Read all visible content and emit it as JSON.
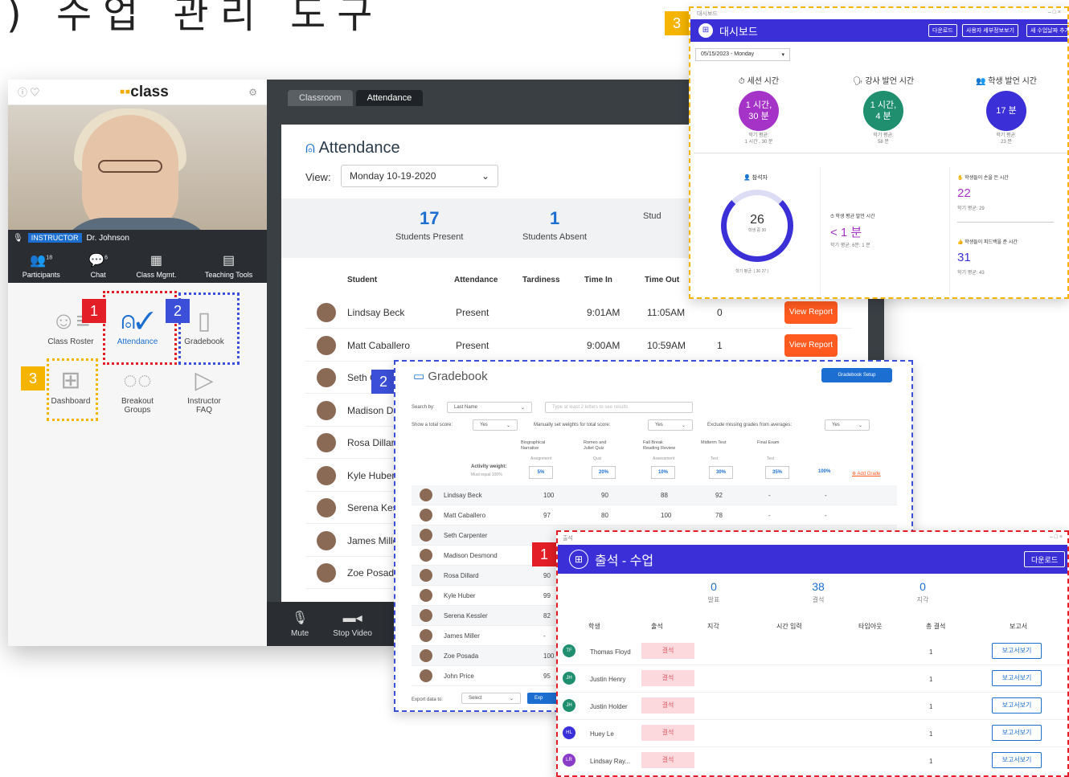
{
  "slide": {
    "title": ") 수업 관리 도구"
  },
  "app": {
    "logo": "class",
    "instructor_badge": "INSTRUCTOR",
    "instructor_name": "Dr. Johnson",
    "toolbar": [
      {
        "label": "Participants",
        "count": "18",
        "icon": "participants-icon"
      },
      {
        "label": "Chat",
        "count": "6",
        "icon": "chat-icon"
      },
      {
        "label": "Class Mgmt.",
        "icon": "class-mgmt-icon"
      },
      {
        "label": "Teaching Tools",
        "icon": "teaching-tools-icon"
      }
    ],
    "grid": [
      {
        "label": "Class Roster",
        "icon": "roster-icon"
      },
      {
        "label": "Attendance",
        "icon": "attendance-icon"
      },
      {
        "label": "Gradebook",
        "icon": "gradebook-icon"
      },
      {
        "label": "Dashboard",
        "icon": "dashboard-icon"
      },
      {
        "label": "Breakout\nGroups",
        "icon": "breakout-icon"
      },
      {
        "label": "Instructor\nFAQ",
        "icon": "faq-icon"
      }
    ],
    "tabs": [
      "Classroom",
      "Attendance"
    ],
    "attendance": {
      "title": "Attendance",
      "view_label": "View:",
      "view_value": "Monday 10-19-2020",
      "stats": [
        {
          "value": "17",
          "label": "Students Present"
        },
        {
          "value": "1",
          "label": "Students Absent"
        },
        {
          "value": "",
          "label": "Stud"
        }
      ],
      "columns": [
        "Student",
        "Attendance",
        "Tardiness",
        "Time In",
        "Time Out"
      ],
      "rows": [
        {
          "name": "Lindsay Beck",
          "attendance": "Present",
          "time_in": "9:01AM",
          "time_out": "11:05AM",
          "extra": "0",
          "action": "View Report"
        },
        {
          "name": "Matt Caballero",
          "attendance": "Present",
          "time_in": "9:00AM",
          "time_out": "10:59AM",
          "extra": "1",
          "action": "View Report"
        },
        {
          "name": "Seth C"
        },
        {
          "name": "Madison D"
        },
        {
          "name": "Rosa Dillar"
        },
        {
          "name": "Kyle Huber"
        },
        {
          "name": "Serena Kes"
        },
        {
          "name": "James Mille"
        },
        {
          "name": "Zoe Posada"
        }
      ]
    },
    "bottom": [
      {
        "label": "Mute",
        "icon": "mic-icon"
      },
      {
        "label": "Stop Video",
        "icon": "video-icon"
      }
    ]
  },
  "badges": {
    "one": "1",
    "two": "2",
    "three": "3"
  },
  "dashboard": {
    "window_label": "대시보드",
    "title": "대시보드",
    "buttons": [
      "다운로드",
      "사용자 세부정보보기",
      "새 수업날짜 추가"
    ],
    "date": "05/15/2023 - Monday",
    "metrics": [
      {
        "title": "세션 시간",
        "value": "1 시간,\n30 분",
        "sub": "학기 평균:\n1 시간 , 30 분",
        "color": "#a533c8"
      },
      {
        "title": "강사 발언 시간",
        "value": "1 시간,\n4 분",
        "sub": "학기 평균:\n58 분",
        "color": "#1f8f70"
      },
      {
        "title": "학생 발언 시간",
        "value": "17 분",
        "sub": "학기 평균:\n23 분",
        "color": "#3b2fd8"
      }
    ],
    "participants_label": "참석자",
    "ring_value": "26",
    "ring_sub": "학생 중 30",
    "ring_avg": "학기 평균: ( 30 27 )",
    "avg_speak_label": "학생 평균 발언 시간",
    "avg_speak_value": "< 1 분",
    "avg_speak_sub": "학기 평균: 6분: 1 분",
    "hands_label": "학생들이 손을 든 시간",
    "hands_value": "22",
    "hands_sub": "학기 평균: 29",
    "feedback_label": "학생들이 피드백을 준 시간",
    "feedback_value": "31",
    "feedback_sub": "학기 평균: 43"
  },
  "gradebook": {
    "title": "Gradebook",
    "setup": "Gradebook Setup",
    "search_by": "Search by:",
    "search_sel": "Last Name",
    "search_ph": "Type at least 2 letters to see results",
    "show_total": "Show a total score:",
    "show_total_val": "Yes",
    "manual": "Manually set weights for total score:",
    "manual_val": "Yes",
    "exclude": "Exclude missing grades from averages:",
    "exclude_val": "Yes",
    "assignments": [
      {
        "name": "Biographical\nNarrative",
        "type": "Assignment",
        "weight": "5%"
      },
      {
        "name": "Romeo and\nJuliet Quiz",
        "type": "Quiz",
        "weight": "20%"
      },
      {
        "name": "Fall Break\nReading Review",
        "type": "Assessment",
        "weight": "10%"
      },
      {
        "name": "Midterm Test",
        "type": "Test",
        "weight": "30%"
      },
      {
        "name": "Final Exam",
        "type": "Test",
        "weight": "35%"
      }
    ],
    "activity_weight": "Activity weight:",
    "must_equal": "Must equal 100%",
    "total_weight": "100%",
    "add_grade": "Add Grade",
    "rows": [
      {
        "name": "Lindsay Beck",
        "s": [
          "100",
          "90",
          "88",
          "92",
          "-",
          "-"
        ]
      },
      {
        "name": "Matt Caballero",
        "s": [
          "97",
          "80",
          "100",
          "78",
          "-",
          "-"
        ]
      },
      {
        "name": "Seth Carpenter",
        "s": []
      },
      {
        "name": "Madison Desmond",
        "s": []
      },
      {
        "name": "Rosa Dillard",
        "s": [
          "90"
        ]
      },
      {
        "name": "Kyle Huber",
        "s": [
          "99"
        ]
      },
      {
        "name": "Serena Kessler",
        "s": [
          "82"
        ]
      },
      {
        "name": "James Miller",
        "s": [
          "-"
        ]
      },
      {
        "name": "Zoe Posada",
        "s": [
          "100"
        ]
      },
      {
        "name": "John Price",
        "s": [
          "95"
        ]
      }
    ],
    "export": "Export data to:",
    "export_sel": "Select",
    "export_btn": "Exp"
  },
  "attendance_kr": {
    "window_label": "출석",
    "title": "출석 - 수업",
    "download": "다운로드",
    "stats": [
      {
        "value": "0",
        "label": "발표"
      },
      {
        "value": "38",
        "label": "결석"
      },
      {
        "value": "0",
        "label": "지각"
      }
    ],
    "columns": [
      "학생",
      "출석",
      "지각",
      "시간 입력",
      "타임아웃",
      "총 결석",
      "보고서"
    ],
    "rows": [
      {
        "initials": "TF",
        "name": "Thomas Floyd",
        "status": "결석",
        "total": "1",
        "report": "보고서보기",
        "color": "#1f8f70"
      },
      {
        "initials": "JH",
        "name": "Justin Henry",
        "status": "결석",
        "total": "1",
        "report": "보고서보기",
        "color": "#1f8f70"
      },
      {
        "initials": "JH",
        "name": "Justin Holder",
        "status": "결석",
        "total": "1",
        "report": "보고서보기",
        "color": "#1f8f70"
      },
      {
        "initials": "HL",
        "name": "Huey Le",
        "status": "결석",
        "total": "1",
        "report": "보고서보기",
        "color": "#3b2fd8"
      },
      {
        "initials": "LR",
        "name": "Lindsay Ray...",
        "status": "결석",
        "total": "1",
        "report": "보고서보기",
        "color": "#8a3bc8"
      }
    ]
  }
}
